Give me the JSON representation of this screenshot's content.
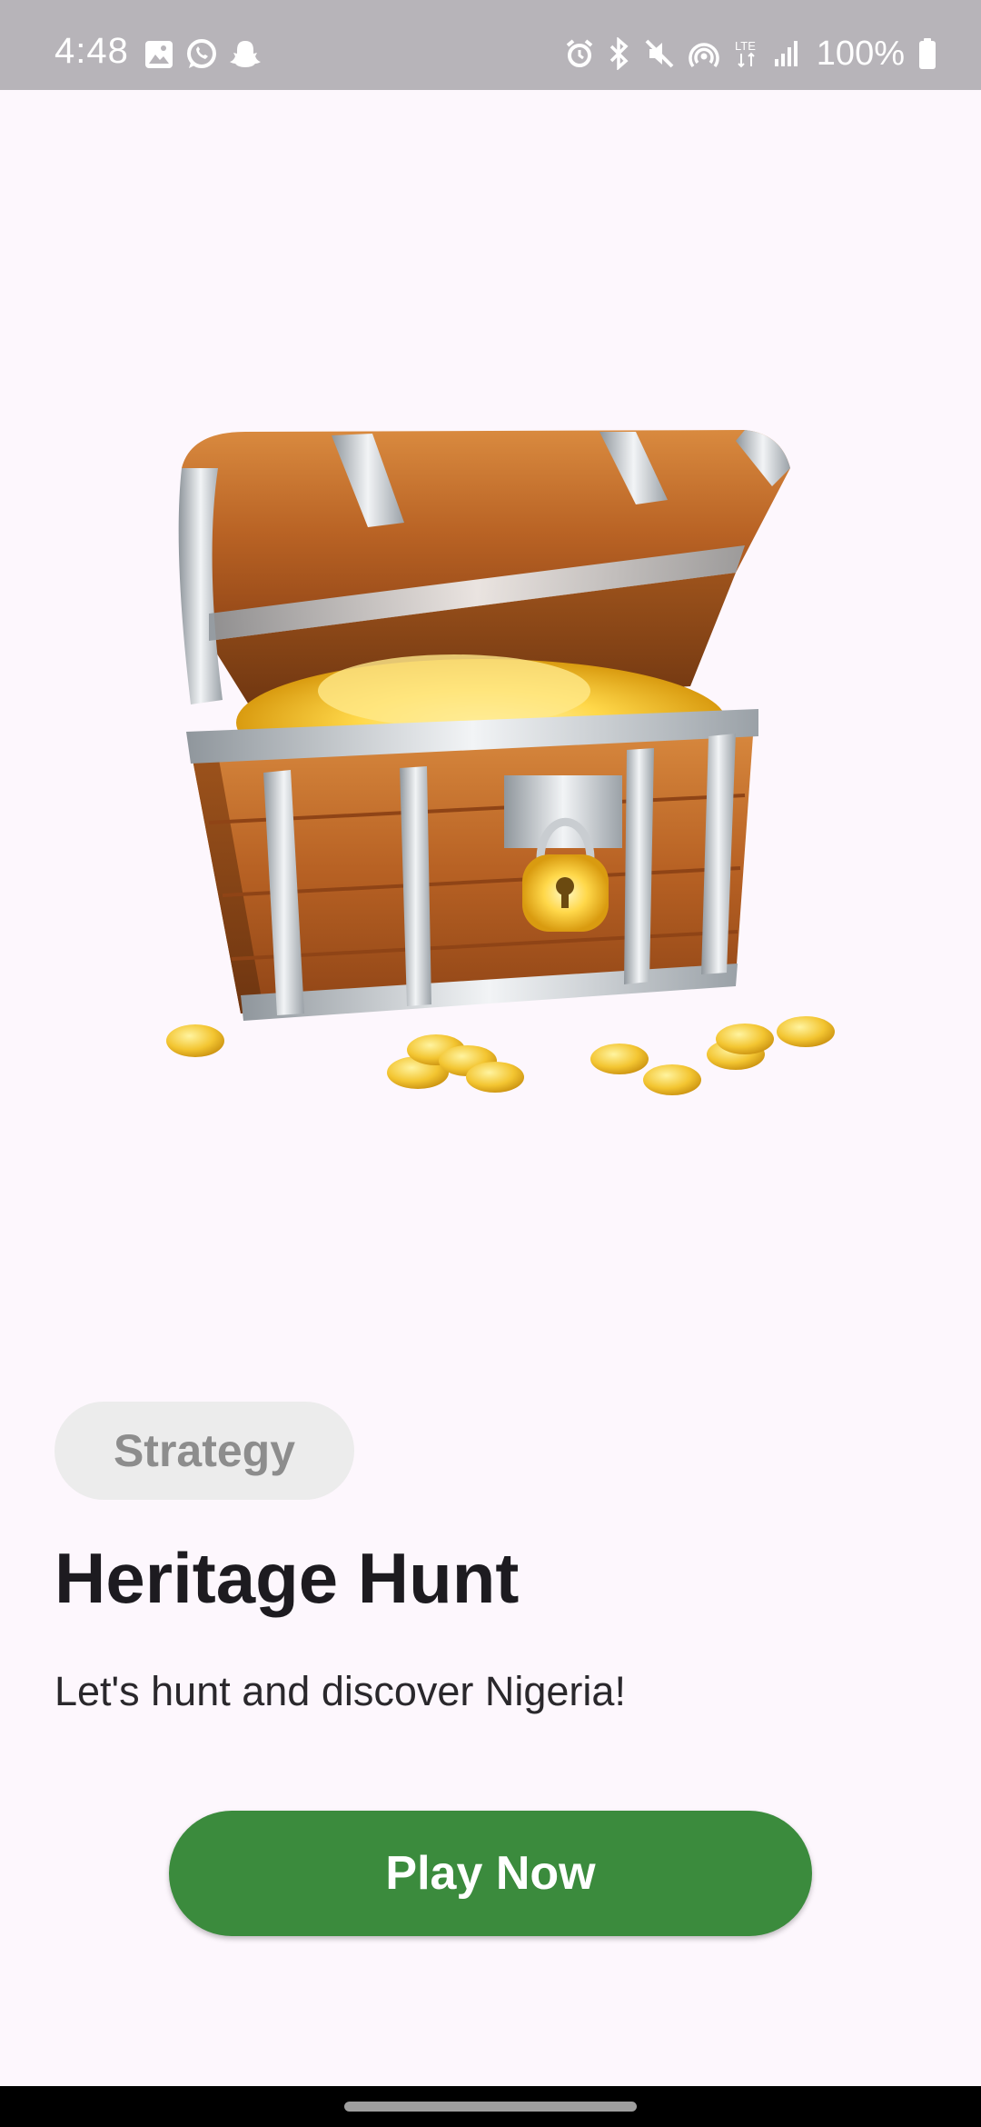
{
  "status_bar": {
    "time": "4:48",
    "battery_percent": "100%",
    "left_icons": [
      "gallery-icon",
      "whatsapp-icon",
      "snapchat-icon"
    ],
    "right_icons": [
      "alarm-icon",
      "bluetooth-icon",
      "mute-icon",
      "hotspot-icon",
      "lte-icon",
      "signal-icon",
      "battery-icon"
    ]
  },
  "hero": {
    "image": "treasure-chest-with-gold-coins"
  },
  "game": {
    "category": "Strategy",
    "title": "Heritage Hunt",
    "tagline": "Let's hunt and discover Nigeria!",
    "play_label": "Play Now"
  },
  "colors": {
    "background": "#fdf7fd",
    "status_bar": "#b7b4b9",
    "chip_background": "#ececec",
    "chip_text": "#8d8d8d",
    "primary_button": "#3b8b3d",
    "title_text": "#1d1b20"
  }
}
